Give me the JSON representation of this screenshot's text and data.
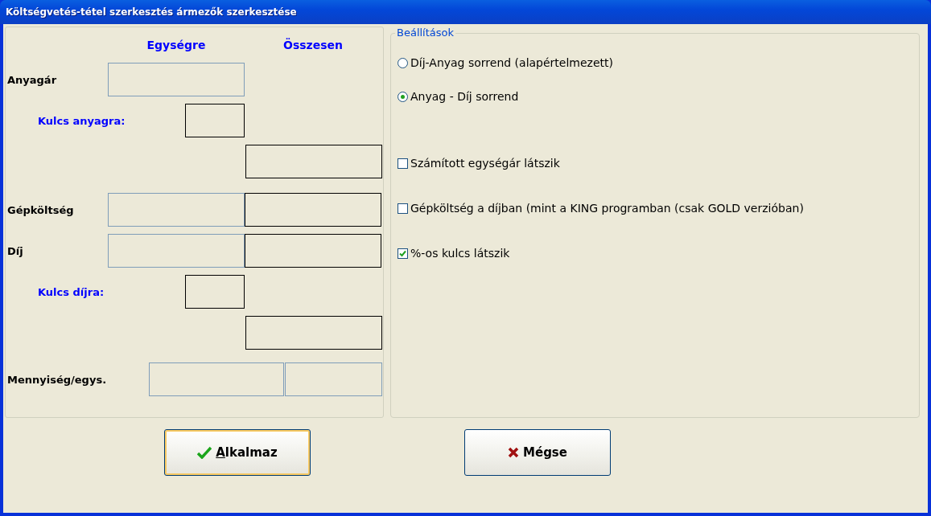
{
  "window": {
    "title": "Költségvetés-tétel szerkesztés ármezők szerkesztése"
  },
  "columns": [
    "Egységre",
    "Összesen"
  ],
  "rows": [
    {
      "kind": "main",
      "label": "Anyagár",
      "unit": {
        "disabled": true
      }
    },
    {
      "kind": "key",
      "label": "Kulcs anyagra:",
      "key": {
        "disabled": false
      }
    },
    {
      "kind": "total",
      "total": {
        "disabled": false
      }
    },
    {
      "kind": "main",
      "label": "Gépköltség",
      "unit": {
        "disabled": true
      },
      "total": {
        "disabled": false
      }
    },
    {
      "kind": "main",
      "label": "Díj",
      "unit": {
        "disabled": true
      },
      "total": {
        "disabled": false
      }
    },
    {
      "kind": "key",
      "label": "Kulcs díjra:",
      "key": {
        "disabled": false
      }
    },
    {
      "kind": "total",
      "total": {
        "disabled": false
      }
    },
    {
      "kind": "quantity",
      "label": "Mennyiség/egys.",
      "unit": {
        "disabled": true
      },
      "total": {
        "disabled": true
      }
    }
  ],
  "settings": {
    "title": "Beállítások",
    "options": [
      {
        "kind": "radio",
        "label": "Díj-Anyag sorrend (alapértelmezett)",
        "selected": false
      },
      {
        "kind": "radio",
        "label": "Anyag - Díj sorrend",
        "selected": true
      },
      {
        "kind": "checkbox",
        "label": "Számított egységár látszik",
        "checked": false
      },
      {
        "kind": "checkbox",
        "label": "Gépköltség a díjban (mint a KING programban (csak GOLD verzióban)",
        "checked": false
      },
      {
        "kind": "checkbox",
        "label": "%-os kulcs látszik",
        "checked": true
      }
    ]
  },
  "buttons": [
    {
      "kind": "ok",
      "label": "Alkalmaz",
      "access_key_underlined": true,
      "focused": true
    },
    {
      "kind": "cancel",
      "label": "Mégse",
      "focused": false
    }
  ]
}
